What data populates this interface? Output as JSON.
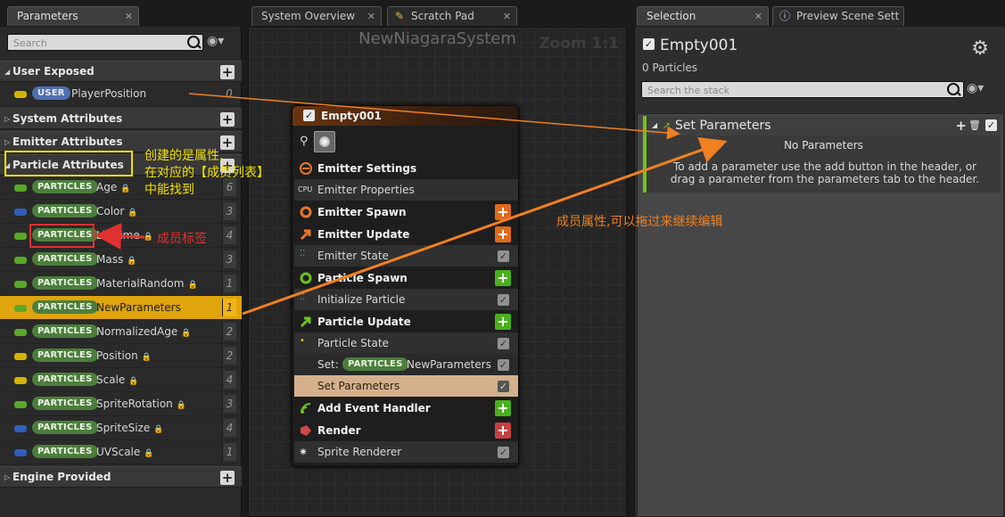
{
  "tabs": {
    "parameters": "Parameters",
    "system_overview": "System Overview",
    "scratch_pad": "Scratch Pad",
    "selection": "Selection",
    "preview": "Preview Scene Sett"
  },
  "left": {
    "search_placeholder": "Search",
    "categories": {
      "user_exposed": "User Exposed",
      "system": "System Attributes",
      "emitter": "Emitter Attributes",
      "particle": "Particle Attributes",
      "engine": "Engine Provided"
    },
    "user_params": [
      {
        "badge": "USER",
        "name": "PlayerPosition",
        "count": "0",
        "pin_color": "#d4b400"
      }
    ],
    "particle_params": [
      {
        "badge": "PARTICLES",
        "name": "Age",
        "count": "6",
        "pin_color": "#5aa82a",
        "locked": true
      },
      {
        "badge": "PARTICLES",
        "name": "Color",
        "count": "3",
        "pin_color": "#2f5fb8",
        "locked": true
      },
      {
        "badge": "PARTICLES",
        "name": "Lifetime",
        "count": "4",
        "pin_color": "#5aa82a",
        "locked": true
      },
      {
        "badge": "PARTICLES",
        "name": "Mass",
        "count": "3",
        "pin_color": "#5aa82a",
        "locked": true
      },
      {
        "badge": "PARTICLES",
        "name": "MaterialRandom",
        "count": "1",
        "pin_color": "#5aa82a",
        "locked": true
      },
      {
        "badge": "PARTICLES",
        "name": "NewParameters",
        "count": "1",
        "pin_color": "#5aa82a",
        "locked": false,
        "selected": true
      },
      {
        "badge": "PARTICLES",
        "name": "NormalizedAge",
        "count": "2",
        "pin_color": "#5aa82a",
        "locked": true
      },
      {
        "badge": "PARTICLES",
        "name": "Position",
        "count": "2",
        "pin_color": "#d4b400",
        "locked": true
      },
      {
        "badge": "PARTICLES",
        "name": "Scale",
        "count": "4",
        "pin_color": "#d4b400",
        "locked": true
      },
      {
        "badge": "PARTICLES",
        "name": "SpriteRotation",
        "count": "3",
        "pin_color": "#5aa82a",
        "locked": true
      },
      {
        "badge": "PARTICLES",
        "name": "SpriteSize",
        "count": "4",
        "pin_color": "#2f5fb8",
        "locked": true
      },
      {
        "badge": "PARTICLES",
        "name": "UVScale",
        "count": "1",
        "pin_color": "#2f5fb8",
        "locked": true
      }
    ]
  },
  "graph": {
    "title": "NewNiagaraSystem",
    "zoom": "Zoom 1:1",
    "node": {
      "name": "Empty001",
      "emitter_settings": "Emitter Settings",
      "emitter_properties": "Emitter Properties",
      "emitter_spawn": "Emitter Spawn",
      "emitter_update": "Emitter Update",
      "emitter_state": "Emitter State",
      "particle_spawn": "Particle Spawn",
      "initialize_particle": "Initialize Particle",
      "particle_update": "Particle Update",
      "particle_state": "Particle State",
      "set_prefix": "Set:",
      "set_badge": "PARTICLES",
      "set_name": "NewParameters",
      "set_parameters": "Set Parameters",
      "add_event_handler": "Add Event Handler",
      "render": "Render",
      "sprite_renderer": "Sprite Renderer",
      "cpu_label": "CPU"
    }
  },
  "right": {
    "title": "Empty001",
    "particles": "0 Particles",
    "search_placeholder": "Search the stack",
    "module_title": "Set Parameters",
    "no_params": "No Parameters",
    "hint": "To add a parameter use the add button in the header, or drag a parameter from the parameters tab to the header."
  },
  "annotations": {
    "created_note": "创建的是属性,\n在对应的【成员列表】\n中能找到",
    "member_tag": "成员标签",
    "member_attr": "成员属性,可以拖过来继续编辑",
    "colors": {
      "yellow": "#f0e000",
      "red": "#e03030",
      "orange": "#f08020"
    }
  }
}
